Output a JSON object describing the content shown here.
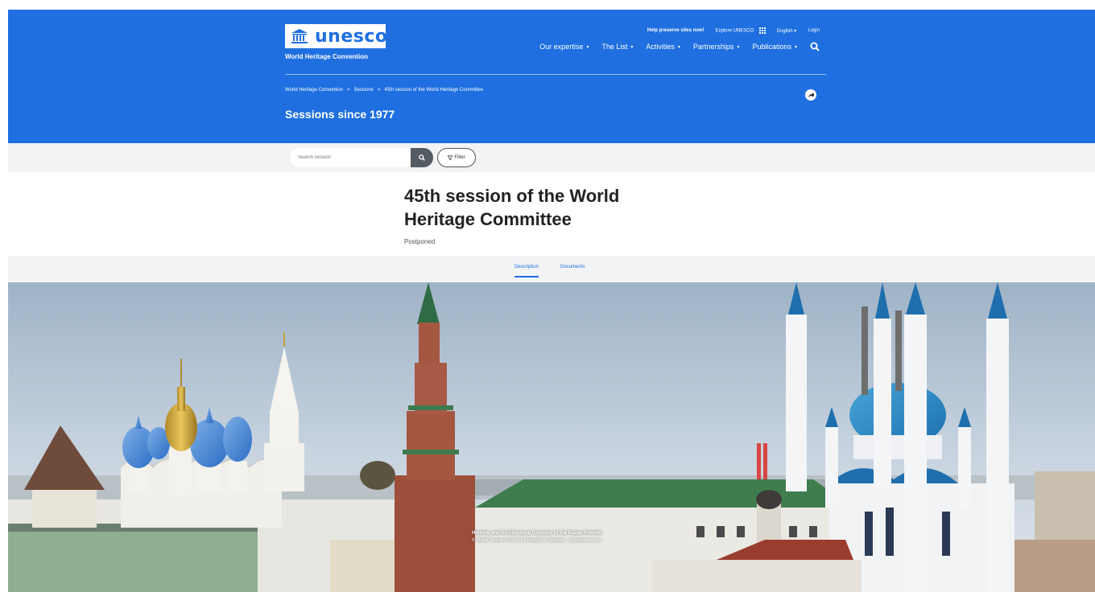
{
  "header": {
    "logo_text": "unesco",
    "logo_subtitle": "World Heritage Convention",
    "top_links": [
      "Help preserve sites now!",
      "Explore UNESCO",
      "English",
      "Login"
    ],
    "nav_items": [
      "Our expertise",
      "The List",
      "Activities",
      "Partnerships",
      "Publications"
    ],
    "breadcrumb": [
      "World Heritage Convention",
      "Sessions",
      "45th session of the World Heritage Committee"
    ],
    "breadcrumb_separator": ">",
    "page_title": "Sessions since 1977"
  },
  "search": {
    "placeholder": "Search session",
    "filter_label": "Filter"
  },
  "session": {
    "title": "45th session of the World Heritage Committee",
    "status": "Postponed"
  },
  "tabs": [
    "Description",
    "Documents"
  ],
  "hero": {
    "caption_title": "Historic and Architectural Complex of the Kazan Kremlin",
    "caption_credit": "© Official Tourism Portal of the Republic of Tatarstan - visit-tatarstan.com"
  },
  "colors": {
    "brand_blue": "#1f6fe0",
    "band_gray": "#f2f3f5",
    "search_button": "#555b63"
  },
  "icons": [
    "unesco-temple-icon",
    "grid-icon",
    "chevron-down-icon",
    "search-icon",
    "share-icon",
    "filter-icon"
  ]
}
